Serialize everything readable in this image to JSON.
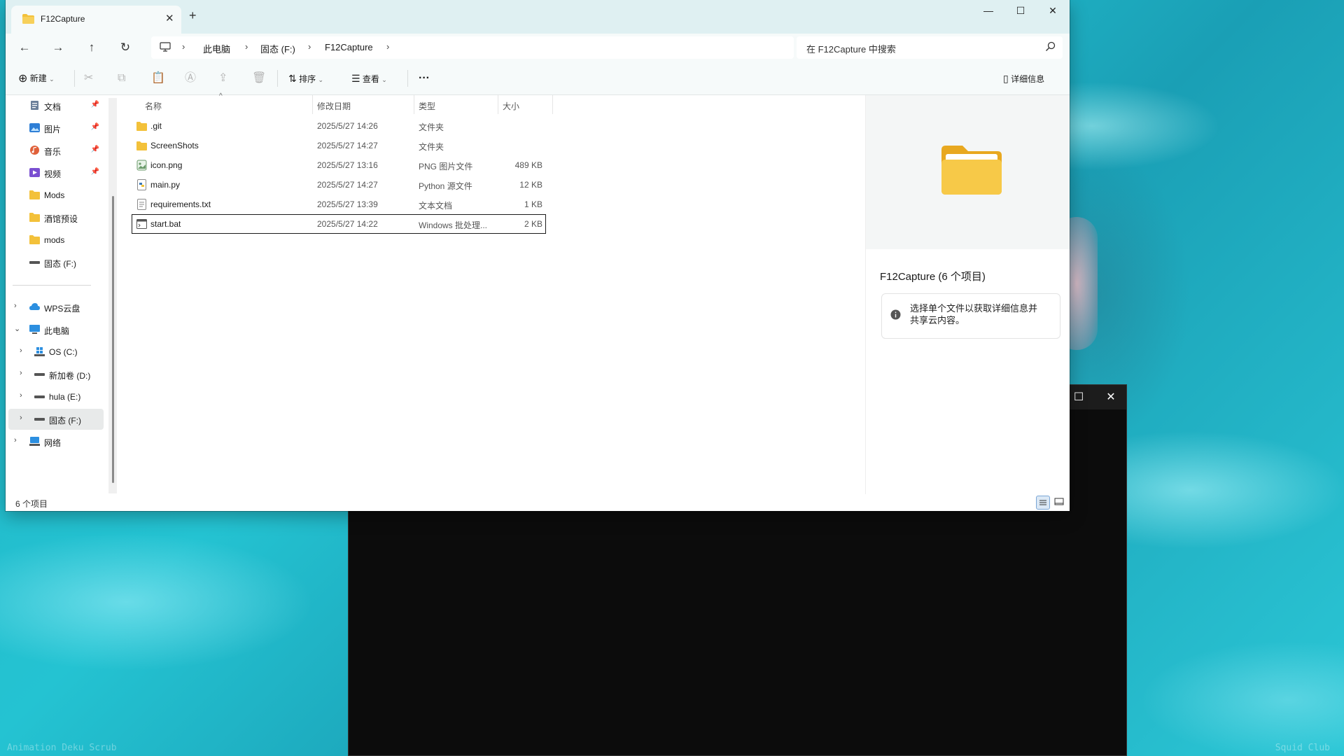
{
  "desktop": {
    "watermark_left": "Animation Deku Scrub",
    "watermark_right": "Squid Club"
  },
  "explorer": {
    "tab_title": "F12Capture",
    "tab_close": "✕",
    "new_tab": "+",
    "window_controls": {
      "minimize": "—",
      "maximize": "☐",
      "close": "✕"
    },
    "nav": {
      "back": "←",
      "forward": "→",
      "up": "↑",
      "refresh": "↻"
    },
    "breadcrumb": [
      "此电脑",
      "固态 (F:)",
      "F12Capture"
    ],
    "search_placeholder": "在 F12Capture 中搜索",
    "toolbar": {
      "new_label": "新建",
      "sort_label": "排序",
      "view_label": "查看",
      "more_label": "···",
      "details_label": "详细信息"
    },
    "sidebar": {
      "quick_access": [
        {
          "label": "文档",
          "icon": "documents-icon",
          "pinned": true
        },
        {
          "label": "图片",
          "icon": "pictures-icon",
          "pinned": true
        },
        {
          "label": "音乐",
          "icon": "music-icon",
          "pinned": true
        },
        {
          "label": "视频",
          "icon": "videos-icon",
          "pinned": true
        },
        {
          "label": "Mods",
          "icon": "folder-icon"
        },
        {
          "label": "酒馆预设",
          "icon": "folder-icon"
        },
        {
          "label": "mods",
          "icon": "folder-icon"
        },
        {
          "label": "固态 (F:)",
          "icon": "drive-icon"
        }
      ],
      "tree": [
        {
          "label": "WPS云盘",
          "icon": "cloud-icon"
        },
        {
          "label": "此电脑",
          "icon": "pc-icon",
          "expanded": true
        },
        {
          "label": "OS (C:)",
          "icon": "windows-drive-icon"
        },
        {
          "label": "新加卷 (D:)",
          "icon": "drive-icon"
        },
        {
          "label": "hula (E:)",
          "icon": "drive-icon"
        },
        {
          "label": "固态 (F:)",
          "icon": "drive-icon",
          "selected": true
        },
        {
          "label": "网络",
          "icon": "network-icon"
        }
      ]
    },
    "columns": {
      "name": "名称",
      "modified": "修改日期",
      "type": "类型",
      "size": "大小"
    },
    "files": [
      {
        "name": ".git",
        "modified": "2025/5/27 14:26",
        "type": "文件夹",
        "size": "",
        "icon": "folder-icon"
      },
      {
        "name": "ScreenShots",
        "modified": "2025/5/27 14:27",
        "type": "文件夹",
        "size": "",
        "icon": "folder-icon"
      },
      {
        "name": "icon.png",
        "modified": "2025/5/27 13:16",
        "type": "PNG 图片文件",
        "size": "489 KB",
        "icon": "image-file-icon"
      },
      {
        "name": "main.py",
        "modified": "2025/5/27 14:27",
        "type": "Python 源文件",
        "size": "12 KB",
        "icon": "python-file-icon"
      },
      {
        "name": "requirements.txt",
        "modified": "2025/5/27 13:39",
        "type": "文本文档",
        "size": "1 KB",
        "icon": "text-file-icon"
      },
      {
        "name": "start.bat",
        "modified": "2025/5/27 14:22",
        "type": "Windows 批处理...",
        "size": "2 KB",
        "icon": "batch-file-icon",
        "focused": true
      }
    ],
    "details_pane": {
      "title": "F12Capture (6 个项目)",
      "message_line1": "选择单个文件以获取详细信息并",
      "message_line2": "共享云内容。"
    },
    "status": "6 个项目"
  },
  "terminal": {
    "maximize": "☐",
    "close": "✕"
  },
  "colors": {
    "accent": "#0067c0",
    "folder": "#f3c13a",
    "wallpaper": "#1fb2c4"
  }
}
